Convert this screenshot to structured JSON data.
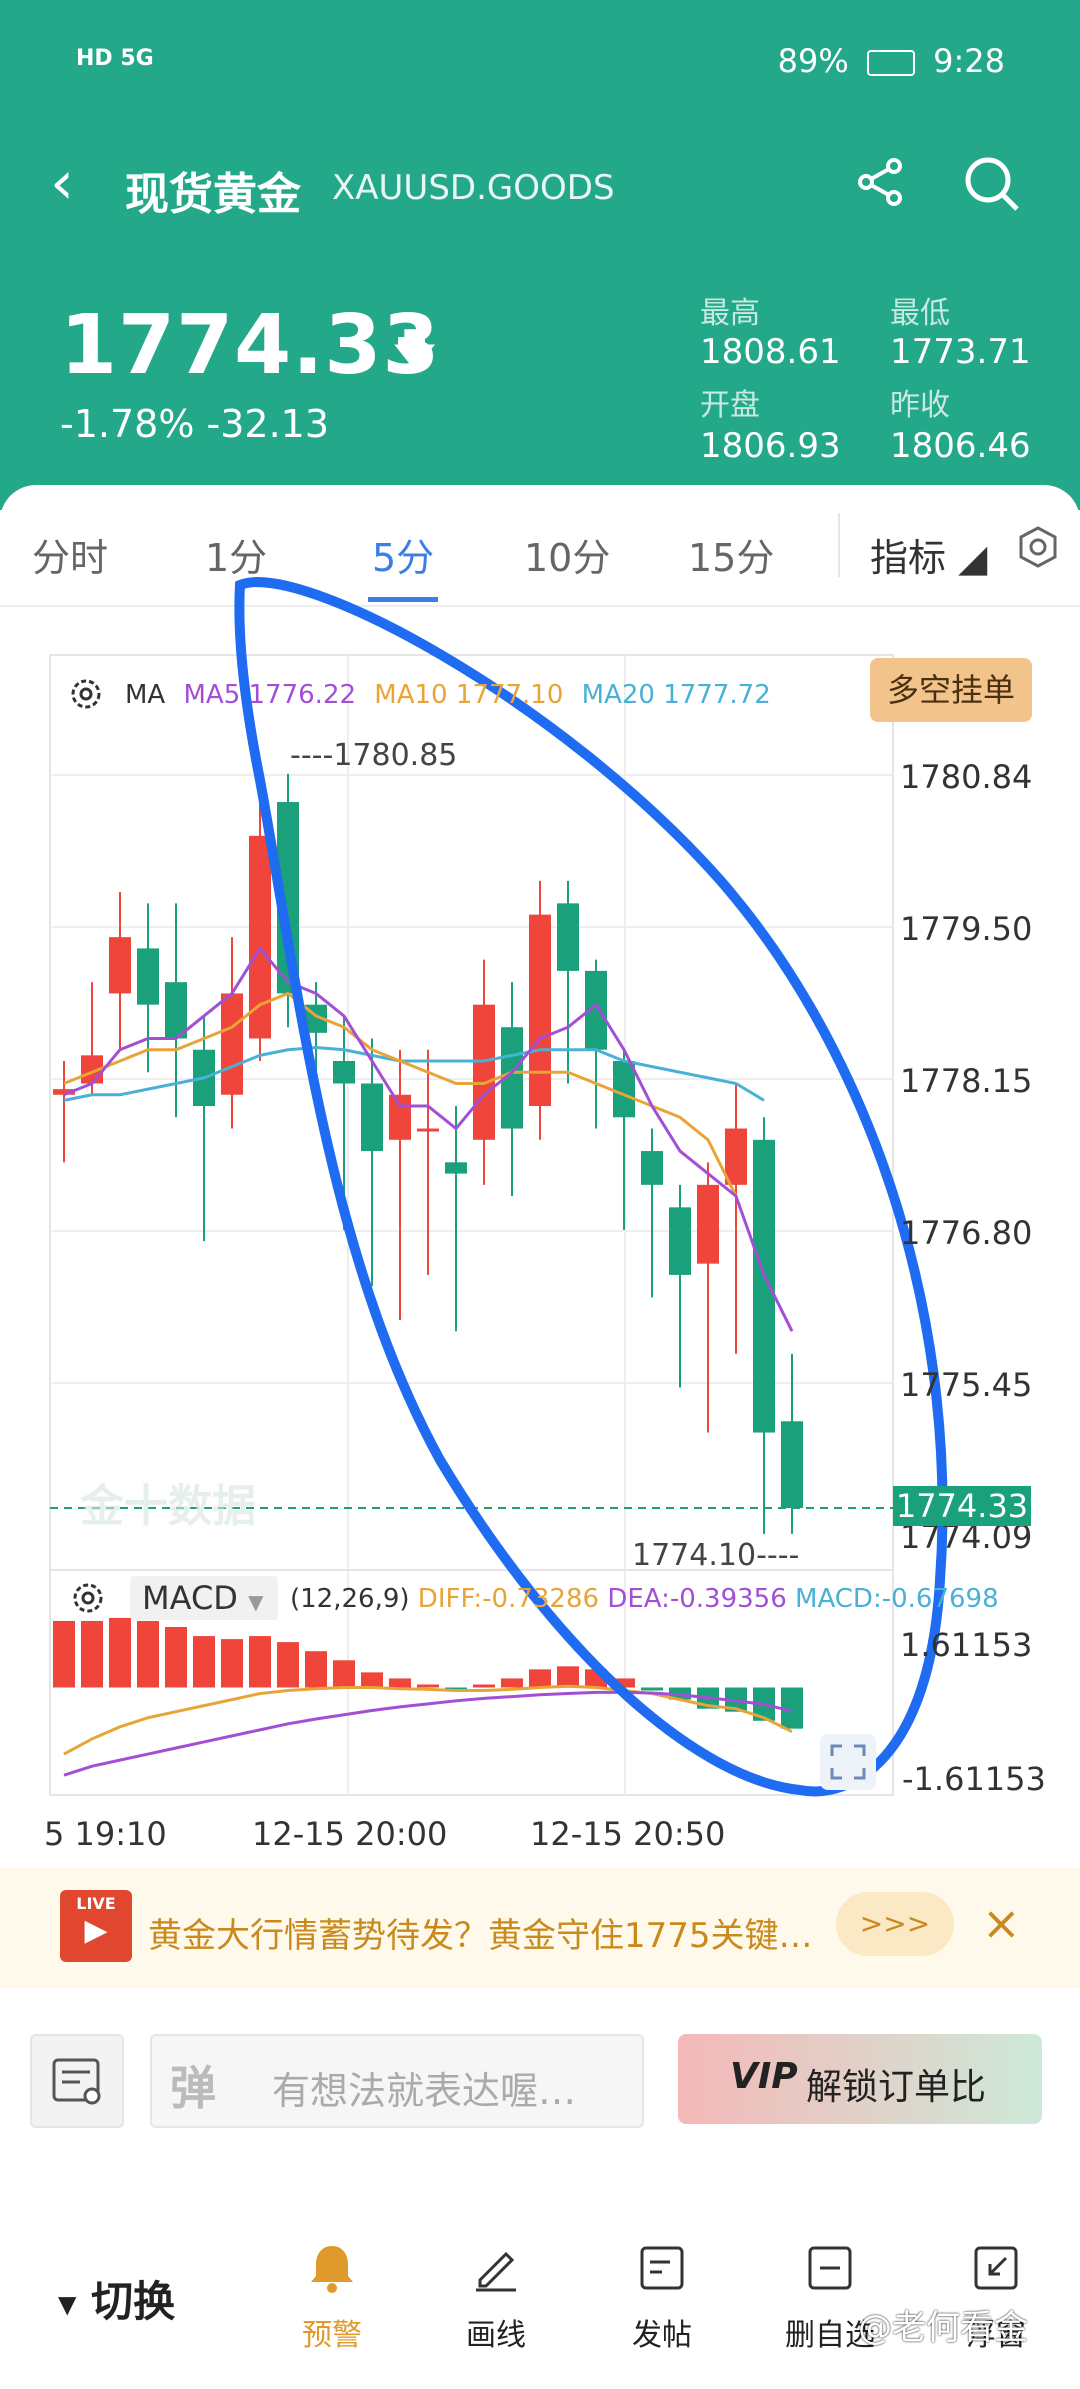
{
  "status_bar": {
    "network": "HD 5G",
    "battery": "89%",
    "time": "9:28"
  },
  "header": {
    "title": "现货黄金",
    "symbol": "XAUUSD.GOODS",
    "price": "1774.33",
    "change": "-1.78% -32.13",
    "stats": [
      {
        "label": "最高",
        "value": "1808.61"
      },
      {
        "label": "最低",
        "value": "1773.71"
      },
      {
        "label": "开盘",
        "value": "1806.93"
      },
      {
        "label": "昨收",
        "value": "1806.46"
      }
    ]
  },
  "tabs": {
    "items": [
      "分时",
      "1分",
      "5分",
      "10分",
      "15分",
      "指标"
    ],
    "active": "5分"
  },
  "ma_legend": {
    "ma": "MA",
    "ma5": "MA5 1776.22",
    "ma10": "MA10 1777.10",
    "ma20": "MA20 1777.72"
  },
  "long_short_button": "多空挂单",
  "y_axis": [
    "1780.84",
    "1779.50",
    "1778.15",
    "1776.80",
    "1775.45",
    "1774.09"
  ],
  "current_price_tag": "1774.33",
  "high_annotation": "1780.85",
  "low_annotation": "1774.10",
  "chart_watermark": "金十数据",
  "macd": {
    "selector": "MACD",
    "params": "(12,26,9)",
    "diff": "DIFF:-0.73286",
    "dea": "DEA:-0.39356",
    "macd": "MACD:-0.67698",
    "y_top": "1.61153",
    "y_bottom": "-1.61153"
  },
  "x_axis": [
    "5 19:10",
    "12-15 20:00",
    "12-15 20:50"
  ],
  "colors": {
    "up": "#F0453A",
    "down": "#1AA07A",
    "brand": "#23A889",
    "ma5": "#A24FD6",
    "ma10": "#E8A437",
    "ma20": "#49B1D6",
    "annotation": "#1F6BF2"
  },
  "chart_data": {
    "type": "candlestick",
    "series": [
      {
        "o": 1778.0,
        "c": 1778.05,
        "h": 1778.3,
        "l": 1777.4
      },
      {
        "o": 1778.1,
        "c": 1778.35,
        "h": 1779.0,
        "l": 1778.0
      },
      {
        "o": 1778.9,
        "c": 1779.4,
        "h": 1779.8,
        "l": 1778.4
      },
      {
        "o": 1779.3,
        "c": 1778.8,
        "h": 1779.7,
        "l": 1778.2
      },
      {
        "o": 1779.0,
        "c": 1778.5,
        "h": 1779.7,
        "l": 1777.8
      },
      {
        "o": 1778.4,
        "c": 1777.9,
        "h": 1778.7,
        "l": 1776.7
      },
      {
        "o": 1778.0,
        "c": 1778.9,
        "h": 1779.4,
        "l": 1777.7
      },
      {
        "o": 1778.5,
        "c": 1780.3,
        "h": 1780.85,
        "l": 1778.3
      },
      {
        "o": 1780.6,
        "c": 1778.9,
        "h": 1780.85,
        "l": 1778.6
      },
      {
        "o": 1778.8,
        "c": 1778.55,
        "h": 1779.0,
        "l": 1778.0
      },
      {
        "o": 1778.3,
        "c": 1778.1,
        "h": 1778.7,
        "l": 1776.8
      },
      {
        "o": 1778.1,
        "c": 1777.5,
        "h": 1778.5,
        "l": 1776.3
      },
      {
        "o": 1777.6,
        "c": 1778.0,
        "h": 1778.4,
        "l": 1776.0
      },
      {
        "o": 1777.7,
        "c": 1777.7,
        "h": 1778.4,
        "l": 1776.4
      },
      {
        "o": 1777.4,
        "c": 1777.3,
        "h": 1777.9,
        "l": 1775.9
      },
      {
        "o": 1777.6,
        "c": 1778.8,
        "h": 1779.2,
        "l": 1777.2
      },
      {
        "o": 1778.6,
        "c": 1777.7,
        "h": 1779.0,
        "l": 1777.1
      },
      {
        "o": 1777.9,
        "c": 1779.6,
        "h": 1779.9,
        "l": 1777.6
      },
      {
        "o": 1779.7,
        "c": 1779.1,
        "h": 1779.9,
        "l": 1778.1
      },
      {
        "o": 1779.1,
        "c": 1778.4,
        "h": 1779.2,
        "l": 1777.7
      },
      {
        "o": 1778.3,
        "c": 1777.8,
        "h": 1778.4,
        "l": 1776.8
      },
      {
        "o": 1777.5,
        "c": 1777.2,
        "h": 1777.7,
        "l": 1776.2
      },
      {
        "o": 1777.0,
        "c": 1776.4,
        "h": 1777.2,
        "l": 1775.4
      },
      {
        "o": 1776.5,
        "c": 1777.2,
        "h": 1777.4,
        "l": 1775.0
      },
      {
        "o": 1777.2,
        "c": 1777.7,
        "h": 1778.1,
        "l": 1775.7
      },
      {
        "o": 1777.6,
        "c": 1775.0,
        "h": 1777.8,
        "l": 1774.1
      },
      {
        "o": 1775.1,
        "c": 1774.33,
        "h": 1775.7,
        "l": 1774.1
      }
    ],
    "ma5": [
      1778.0,
      1778.1,
      1778.4,
      1778.5,
      1778.5,
      1778.7,
      1778.9,
      1779.3,
      1779.0,
      1778.9,
      1778.7,
      1778.3,
      1777.9,
      1777.9,
      1777.7,
      1778.0,
      1778.2,
      1778.5,
      1778.6,
      1778.8,
      1778.4,
      1777.9,
      1777.5,
      1777.3,
      1777.1,
      1776.4,
      1775.9
    ],
    "ma10": [
      1778.1,
      1778.2,
      1778.3,
      1778.4,
      1778.4,
      1778.5,
      1778.6,
      1778.8,
      1778.9,
      1778.7,
      1778.6,
      1778.4,
      1778.3,
      1778.2,
      1778.1,
      1778.1,
      1778.2,
      1778.2,
      1778.2,
      1778.1,
      1778.0,
      1777.9,
      1777.8,
      1777.6,
      1777.1
    ],
    "ma20": [
      1777.95,
      1778.0,
      1778.0,
      1778.05,
      1778.1,
      1778.15,
      1778.25,
      1778.35,
      1778.4,
      1778.42,
      1778.4,
      1778.35,
      1778.3,
      1778.3,
      1778.3,
      1778.3,
      1778.35,
      1778.4,
      1778.4,
      1778.4,
      1778.3,
      1778.25,
      1778.2,
      1778.15,
      1778.1,
      1777.95
    ],
    "macd_hist": [
      1.1,
      1.1,
      1.15,
      1.1,
      1.0,
      0.85,
      0.8,
      0.85,
      0.75,
      0.6,
      0.45,
      0.25,
      0.15,
      0.05,
      -0.05,
      0.05,
      0.15,
      0.3,
      0.35,
      0.3,
      0.15,
      -0.05,
      -0.2,
      -0.35,
      -0.4,
      -0.55,
      -0.68
    ],
    "diff": [
      -1.1,
      -0.85,
      -0.65,
      -0.5,
      -0.4,
      -0.3,
      -0.2,
      -0.1,
      -0.05,
      -0.02,
      0.0,
      0.0,
      -0.02,
      -0.03,
      -0.05,
      -0.05,
      -0.03,
      0.0,
      0.02,
      0.0,
      -0.05,
      -0.1,
      -0.2,
      -0.3,
      -0.35,
      -0.5,
      -0.73
    ],
    "dea": [
      -1.45,
      -1.3,
      -1.2,
      -1.1,
      -1.0,
      -0.9,
      -0.8,
      -0.7,
      -0.6,
      -0.52,
      -0.45,
      -0.38,
      -0.32,
      -0.27,
      -0.22,
      -0.18,
      -0.15,
      -0.12,
      -0.1,
      -0.08,
      -0.08,
      -0.09,
      -0.12,
      -0.17,
      -0.22,
      -0.28,
      -0.39
    ],
    "ylim": [
      1774.09,
      1780.84
    ],
    "macd_ylim": [
      -1.61153,
      1.61153
    ]
  },
  "news": {
    "badge": "LIVE",
    "text": "黄金大行情蓄势待发？黄金守住1775关键…",
    "more": ">>>",
    "close": "×"
  },
  "comment": {
    "placeholder": "有想法就表达喔…",
    "vip_badge": "VIP",
    "vip_text": "解锁订单比"
  },
  "bottom_bar": {
    "switch": "切换",
    "items": [
      {
        "label": "预警",
        "icon": "bell-icon"
      },
      {
        "label": "画线",
        "icon": "pen-icon"
      },
      {
        "label": "发帖",
        "icon": "post-icon"
      },
      {
        "label": "删自选",
        "icon": "minus-square-icon"
      },
      {
        "label": "浮窗",
        "icon": "float-window-icon"
      }
    ]
  },
  "watermark": "@老何看金"
}
